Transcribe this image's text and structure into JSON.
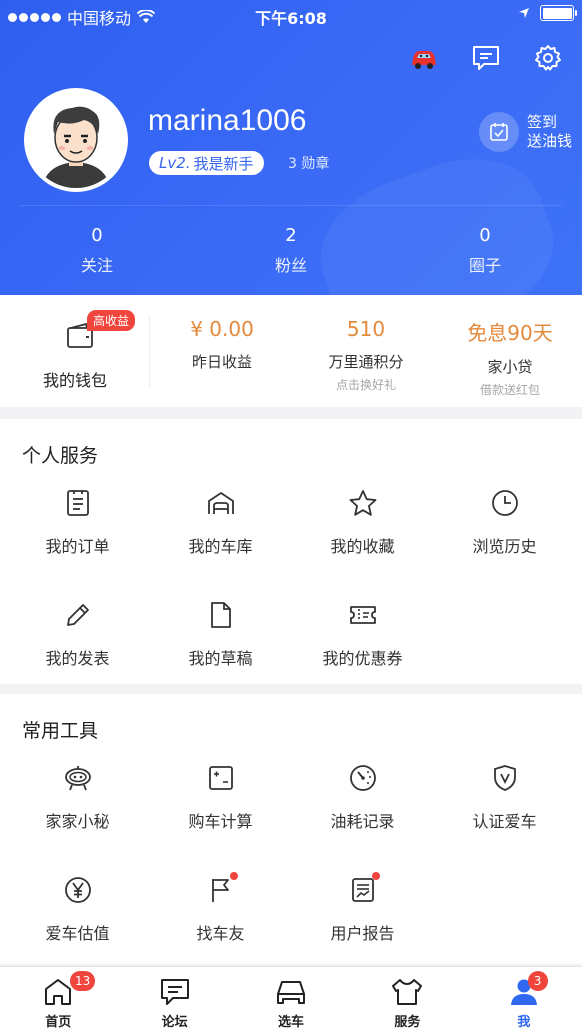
{
  "status_bar": {
    "carrier": "中国移动",
    "time": "下午6:08"
  },
  "profile": {
    "username": "marina1006",
    "level_prefix": "Lv2.",
    "level_text": "我是新手",
    "medals": "3 勋章",
    "checkin_line1": "签到",
    "checkin_line2": "送油钱"
  },
  "stats": [
    {
      "num": "0",
      "label": "关注"
    },
    {
      "num": "2",
      "label": "粉丝"
    },
    {
      "num": "0",
      "label": "圈子"
    }
  ],
  "wallet": {
    "badge": "高收益",
    "label": "我的钱包",
    "items": [
      {
        "value": "¥ 0.00",
        "label": "昨日收益",
        "sub": ""
      },
      {
        "value": "510",
        "label": "万里通积分",
        "sub": "点击换好礼"
      },
      {
        "value": "免息90天",
        "label": "家小贷",
        "sub": "借款送红包"
      }
    ]
  },
  "personal": {
    "title": "个人服务",
    "items": [
      {
        "label": "我的订单",
        "icon": "order-icon"
      },
      {
        "label": "我的车库",
        "icon": "garage-icon"
      },
      {
        "label": "我的收藏",
        "icon": "star-icon"
      },
      {
        "label": "浏览历史",
        "icon": "clock-icon"
      },
      {
        "label": "我的发表",
        "icon": "pencil-icon"
      },
      {
        "label": "我的草稿",
        "icon": "draft-icon"
      },
      {
        "label": "我的优惠券",
        "icon": "coupon-icon"
      }
    ]
  },
  "tools": {
    "title": "常用工具",
    "items": [
      {
        "label": "家家小秘",
        "icon": "robot-icon"
      },
      {
        "label": "购车计算",
        "icon": "calculator-icon"
      },
      {
        "label": "油耗记录",
        "icon": "gauge-icon"
      },
      {
        "label": "认证爱车",
        "icon": "shield-v-icon"
      },
      {
        "label": "爱车估值",
        "icon": "yen-icon"
      },
      {
        "label": "找车友",
        "icon": "flag-icon"
      },
      {
        "label": "用户报告",
        "icon": "report-icon"
      }
    ]
  },
  "tabbar": [
    {
      "label": "首页",
      "badge": "13",
      "icon": "home-icon"
    },
    {
      "label": "论坛",
      "badge": "",
      "icon": "forum-icon"
    },
    {
      "label": "选车",
      "badge": "",
      "icon": "car-icon"
    },
    {
      "label": "服务",
      "badge": "",
      "icon": "service-icon"
    },
    {
      "label": "我",
      "badge": "3",
      "icon": "user-icon"
    }
  ],
  "colors": {
    "header_blue": "#3565ef",
    "accent_orange": "#e48a3c",
    "badge_red": "#f0453c",
    "active_tab": "#2f67f0"
  }
}
